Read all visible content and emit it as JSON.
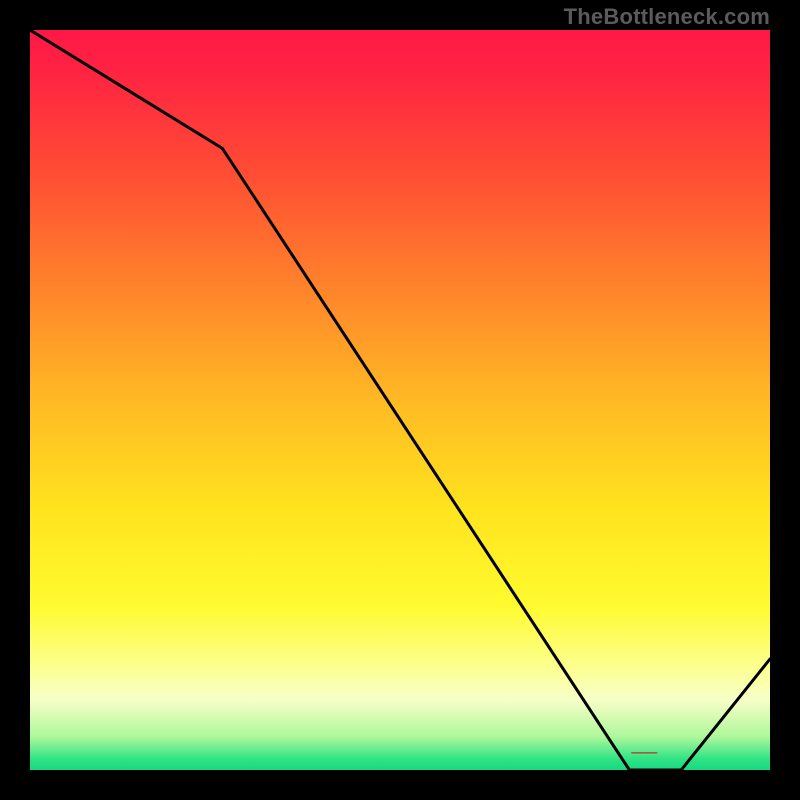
{
  "watermark": "TheBottleneck.com",
  "chart_data": {
    "type": "line",
    "title": "",
    "xlabel": "",
    "ylabel": "",
    "xlim": [
      0,
      100
    ],
    "ylim": [
      0,
      100
    ],
    "grid": false,
    "x": [
      0,
      26,
      81,
      88,
      100
    ],
    "y": [
      100,
      84,
      0,
      0,
      15
    ],
    "annotations": [
      {
        "text_key": "marker_label",
        "x": 83,
        "y": 1.8
      }
    ],
    "marker_label": "——",
    "background_gradient": {
      "stops": [
        {
          "offset": 0.0,
          "color": "#ff1846"
        },
        {
          "offset": 0.06,
          "color": "#ff2442"
        },
        {
          "offset": 0.2,
          "color": "#ff4f33"
        },
        {
          "offset": 0.35,
          "color": "#ff842b"
        },
        {
          "offset": 0.5,
          "color": "#ffb924"
        },
        {
          "offset": 0.65,
          "color": "#ffe41e"
        },
        {
          "offset": 0.78,
          "color": "#fffb30"
        },
        {
          "offset": 0.86,
          "color": "#fcff8e"
        },
        {
          "offset": 0.905,
          "color": "#f7ffc8"
        },
        {
          "offset": 0.955,
          "color": "#aef79a"
        },
        {
          "offset": 0.985,
          "color": "#2fe485"
        },
        {
          "offset": 1.0,
          "color": "#18d880"
        }
      ]
    },
    "series_stroke": "#000000",
    "series_stroke_width": 3,
    "annotation_color": "#b63a2e"
  }
}
